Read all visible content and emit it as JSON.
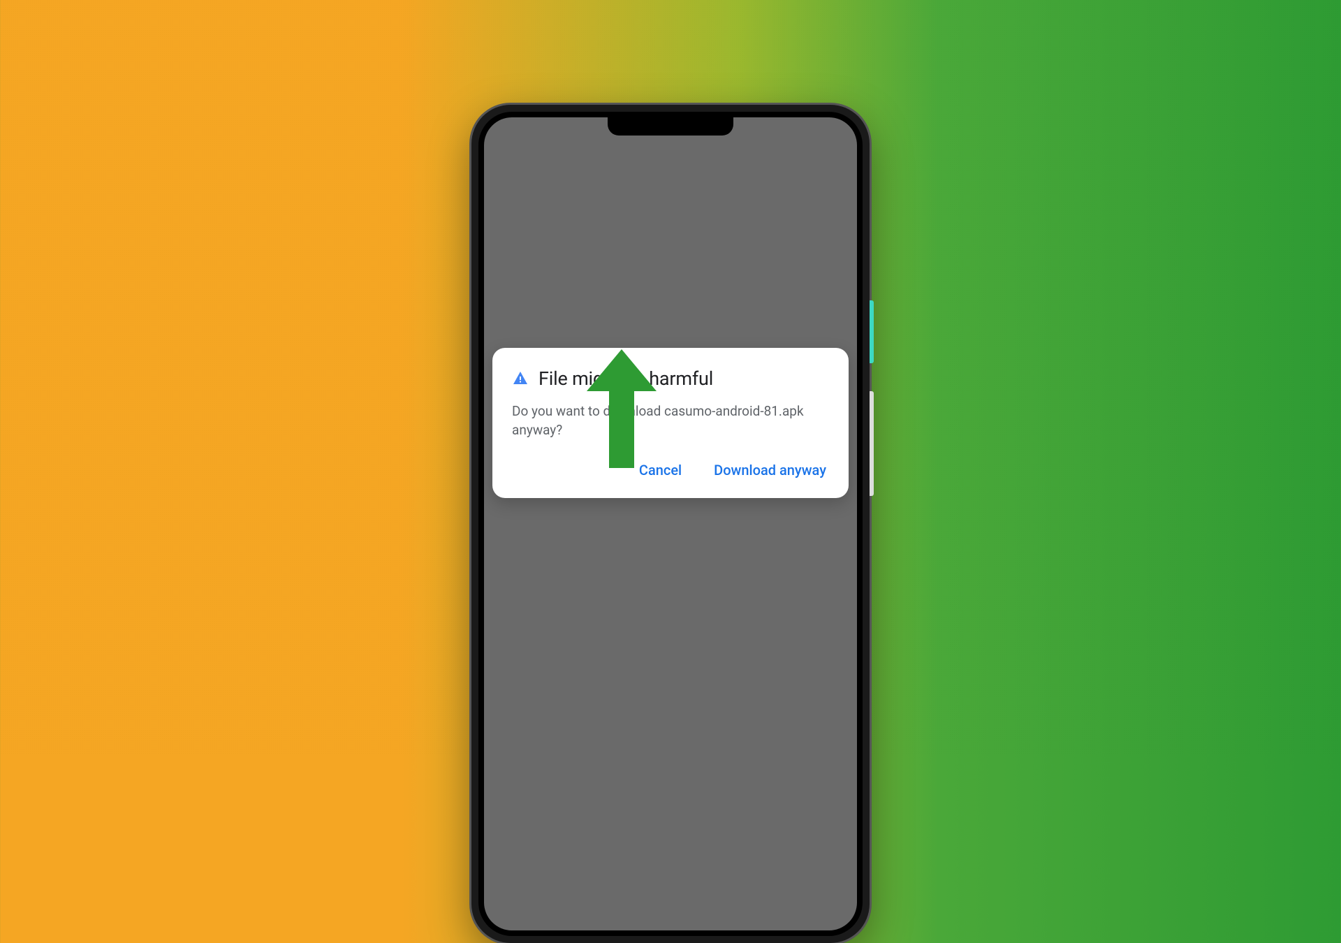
{
  "dialog": {
    "title": "File might be harmful",
    "message": "Do you want to download casumo-android-81.apk anyway?",
    "cancel_label": "Cancel",
    "download_label": "Download anyway"
  },
  "colors": {
    "dialog_action": "#1a73e8",
    "arrow": "#2e9b33",
    "warning_icon": "#4285f4"
  }
}
